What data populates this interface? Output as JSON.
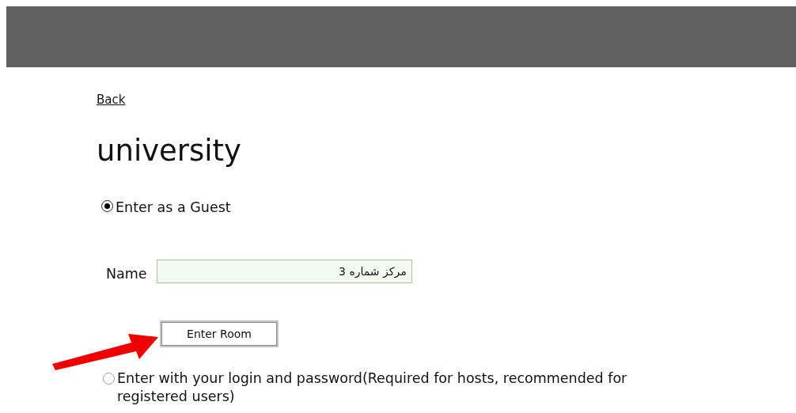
{
  "back_link": "Back",
  "title": "university",
  "options": [
    {
      "label": "Enter as a Guest",
      "selected": true
    },
    {
      "label": "Enter with your login and password(Required for hosts, recommended for registered users)",
      "selected": false
    }
  ],
  "name_field": {
    "label": "Name",
    "value": "مرکز شماره 3"
  },
  "enter_button": "Enter Room"
}
